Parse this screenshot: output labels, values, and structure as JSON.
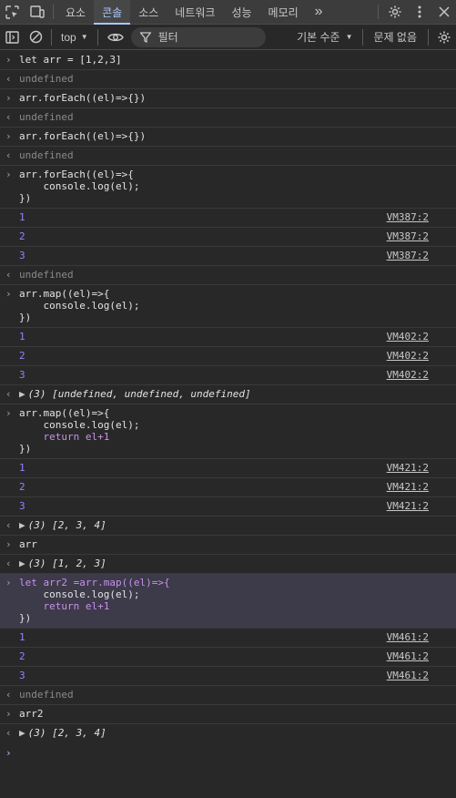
{
  "tabs": [
    "요소",
    "콘솔",
    "소스",
    "네트워크",
    "성능",
    "메모리"
  ],
  "more_tabs": "»",
  "toolbar": {
    "context": "top",
    "filter_placeholder": "필터",
    "levels": "기본 수준",
    "issues": "문제 없음"
  },
  "console": {
    "r1": "let arr = [1,2,3]",
    "undef": "undefined",
    "foreach_empty": "arr.forEach((el)=>{})",
    "foreach_l1": "arr.forEach((el)=>{",
    "console_log": "    console.log(el);",
    "close": "})",
    "map_l1": "arr.map((el)=>{",
    "return_line": "    return el+1",
    "arr": "arr",
    "arr2": "arr2",
    "arr2_l1": "let arr2 =arr.map((el)=>{",
    "vm387": "VM387:2",
    "vm402": "VM402:2",
    "vm421": "VM421:2",
    "vm461": "VM461:2",
    "one": "1",
    "two": "2",
    "three": "3",
    "res_undef": "(3) [undefined, undefined, undefined]",
    "res_234": "(3) [2, 3, 4]",
    "res_123": "(3) [1, 2, 3]"
  }
}
